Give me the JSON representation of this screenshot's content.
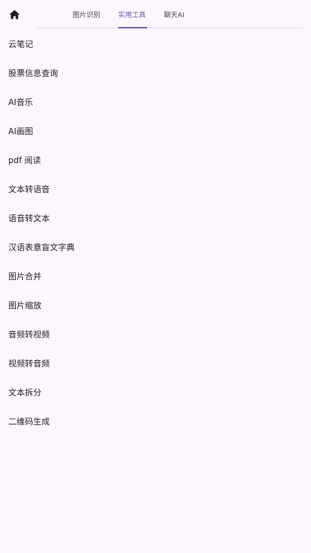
{
  "header": {
    "home_icon": "home-icon",
    "tabs": [
      {
        "label": "图片识别",
        "active": false
      },
      {
        "label": "实用工具",
        "active": true
      },
      {
        "label": "聊天AI",
        "active": false
      }
    ],
    "accent_color": "#6750a4"
  },
  "tools": {
    "items": [
      {
        "label": "云笔记"
      },
      {
        "label": "股票信息查询"
      },
      {
        "label": "AI音乐"
      },
      {
        "label": "AI画图"
      },
      {
        "label": "pdf 阅读"
      },
      {
        "label": "文本转语音"
      },
      {
        "label": "语音转文本"
      },
      {
        "label": "汉语表意盲文字典"
      },
      {
        "label": "图片合并"
      },
      {
        "label": "图片缩放"
      },
      {
        "label": "音频转视频"
      },
      {
        "label": "视频转音频"
      },
      {
        "label": "文本拆分"
      },
      {
        "label": "二维码生成"
      }
    ]
  }
}
